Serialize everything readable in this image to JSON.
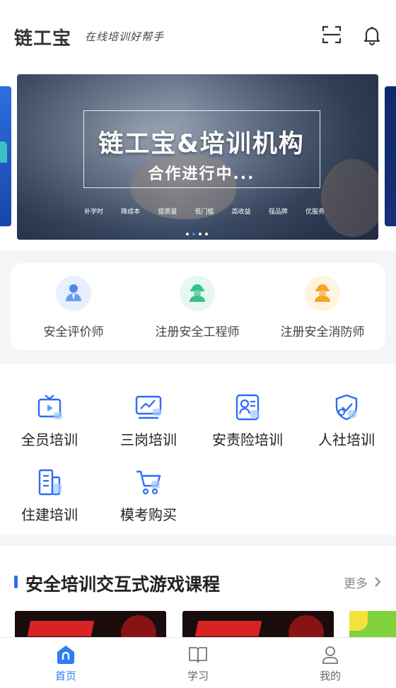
{
  "header": {
    "logo": "链工宝",
    "slogan": "在线培训好帮手",
    "scan_icon": "scan-icon",
    "bell_icon": "bell-icon"
  },
  "banner": {
    "title": "链工宝&培训机构",
    "subtitle": "合作进行中...",
    "tags": [
      "补学时",
      "降成本",
      "提质量",
      "低门槛",
      "高收益",
      "强品牌",
      "优服务"
    ],
    "dots": 4,
    "active_dot": 2
  },
  "certifications": [
    {
      "label": "安全评价师",
      "icon": "evaluator-icon",
      "color": "#e8f0ff"
    },
    {
      "label": "注册安全工程师",
      "icon": "engineer-icon",
      "color": "#e6f8f1"
    },
    {
      "label": "注册安全消防师",
      "icon": "firefighter-icon",
      "color": "#fff4e0"
    }
  ],
  "training": [
    {
      "label": "全员培训",
      "icon": "tv-play-icon"
    },
    {
      "label": "三岗培训",
      "icon": "monitor-chart-icon"
    },
    {
      "label": "安责险培训",
      "icon": "id-card-icon"
    },
    {
      "label": "人社培训",
      "icon": "shield-user-icon"
    },
    {
      "label": "住建培训",
      "icon": "building-icon"
    },
    {
      "label": "模考购买",
      "icon": "cart-icon"
    }
  ],
  "courses": {
    "title": "安全培训交互式游戏课程",
    "more": "更多"
  },
  "tabbar": {
    "items": [
      {
        "label": "首页",
        "icon": "home-icon",
        "active": true
      },
      {
        "label": "学习",
        "icon": "book-icon",
        "active": false
      },
      {
        "label": "我的",
        "icon": "user-icon",
        "active": false
      }
    ]
  },
  "colors": {
    "accent": "#2f6cf6",
    "background": "#f4f5f7"
  }
}
